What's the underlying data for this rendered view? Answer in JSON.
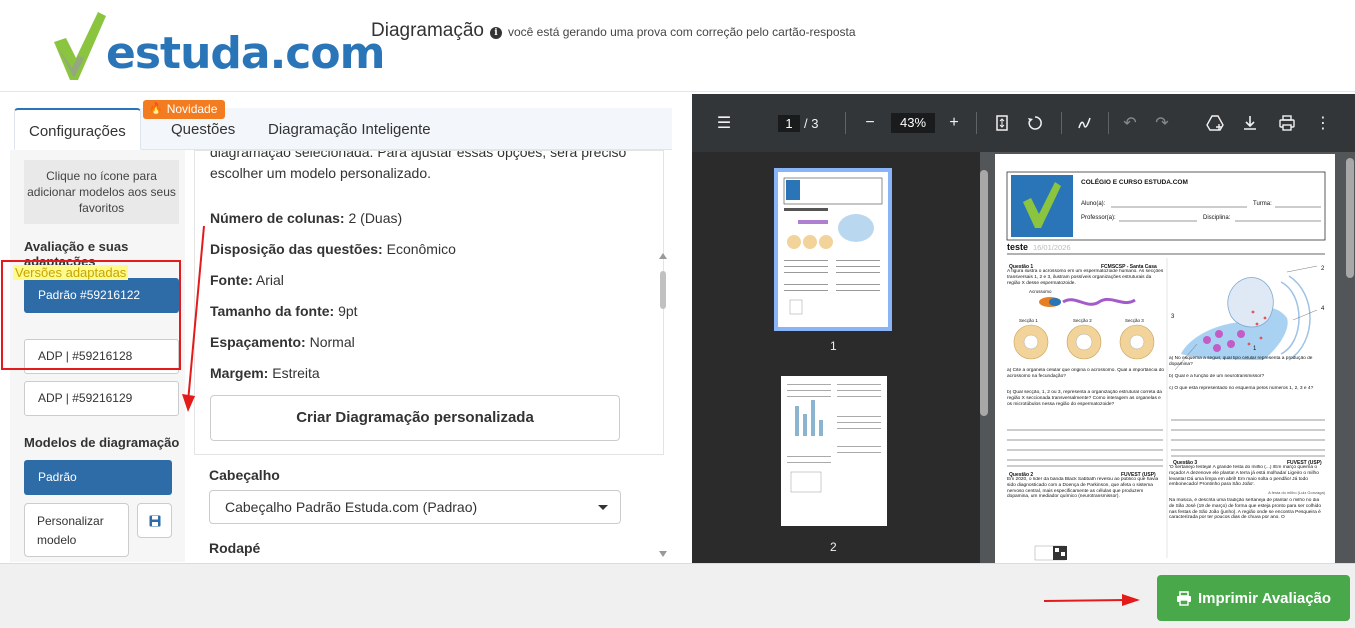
{
  "header": {
    "brand": "estuda.com",
    "page_title": "Diagramação",
    "subtitle": "você está gerando uma prova com correção pelo cartão-resposta"
  },
  "tabs": [
    {
      "label": "Configurações",
      "active": true
    },
    {
      "label": "Questões",
      "active": false
    },
    {
      "label": "Diagramação Inteligente",
      "active": false
    }
  ],
  "badge": {
    "label": "Novidade"
  },
  "sidebar": {
    "favorites_hint": "Clique no ícone para adicionar modelos aos seus favoritos",
    "assessment_label": "Avaliação e suas adaptações",
    "assessment_button": "Padrão #59216122",
    "versions_label": "Versões adaptadas",
    "versions": [
      "ADP | #59216128",
      "ADP | #59216129"
    ],
    "models_label": "Modelos de diagramação",
    "model_default": "Padrão",
    "model_custom": "Personalizar modelo"
  },
  "config": {
    "intro_line1": "diagramação selecionada. Para ajustar essas opções, será preciso",
    "intro_line2": "escolher um modelo personalizado.",
    "properties": [
      {
        "label": "Número de colunas:",
        "value": " 2 (Duas)"
      },
      {
        "label": "Disposição das questões:",
        "value": " Econômico"
      },
      {
        "label": "Fonte:",
        "value": " Arial"
      },
      {
        "label": "Tamanho da fonte:",
        "value": " 9pt"
      },
      {
        "label": "Espaçamento:",
        "value": " Normal"
      },
      {
        "label": "Margem:",
        "value": " Estreita"
      }
    ],
    "create_button": "Criar Diagramação personalizada",
    "header_label": "Cabeçalho",
    "header_select": "Cabeçalho Padrão Estuda.com (Padrao)",
    "footer_label": "Rodapé"
  },
  "viewer": {
    "current_page": "1",
    "total_pages": "/  3",
    "zoom": "43%",
    "thumb_labels": [
      "1",
      "2"
    ],
    "doc": {
      "school": "COLÉGIO E CURSO ESTUDA.COM",
      "student": "Aluno(a):",
      "class": "Turma:",
      "teacher": "Professor(a):",
      "subject": "Disciplina:",
      "test_title": "teste",
      "test_date": "16/01/2026",
      "q1_label": "Questão 1",
      "q1_source": "FCMSCSP - Santa Casa",
      "q1_text": "A figura ilustra o acrossomo em um espermatozoide humano. As secções transversais 1, 2 e 3, ilustram possíveis organizações estruturais da região X desse espermatozoide.",
      "acrossomo": "Acrossomo",
      "secoes": [
        "Secção 1",
        "Secção 2",
        "Secção 3"
      ],
      "q1a": "a) Cite a organela celular que origina o acrossomo. Qual a importância do acrossomo na fecundação?",
      "q1b": "b) Qual secção, 1, 2 ou 3, representa a organização estrutural correta da região X seccionada transversalmente? Como interagem as organelas e os microtúbulos nessa região do espermatozoide?",
      "q2_label": "Questão 2",
      "q2_source": "FUVEST (USP)",
      "q2_text": "Em 2020, o líder da banda Black Sabbath revelou ao público que havia sido diagnosticado com a Doença de Parkinson, que afeta o sistema nervoso central, mais especificamente as células que produzem dopamina, um mediador químico (neurotransmissor).",
      "right_a": "a) No esquema a seguir, qual tipo celular representa a produção de dopamina?",
      "right_b": "b) Qual é a função de um neurotransmissor?",
      "right_c": "c) O que está representado no esquema pelos números 1, 2, 3 e 4?",
      "q3_label": "Questão 3",
      "q3_source": "FUVEST (USP)",
      "q3_text": "'O sertanejo festeja! A grande festa do milho (...) /Em março queima o roçado! A dezenove ele planta! A terra já está molhada/ Ligeiro o milho levanta! Dá uma limpa em abril! Em maio solta o pendão! Já todo embonecado/ Prontinho para São João'.",
      "q3_cite": "A festa do milho (Luiz Gonzaga)",
      "q3_text2": "Na música, é descrita uma tradição sertaneja de plantar o milho no dia de São José (19 de março) de forma que esteja pronto para ser colhido nas festas de São João (junho). A região onde se encontra Pesqueira é caracterizada por ter poucos dias de chuva por ano. O",
      "n1": "1",
      "n2": "2",
      "n3": "3",
      "n4": "4"
    }
  },
  "footer": {
    "print_button": "Imprimir Avaliação"
  },
  "colors": {
    "primary": "#2e6ca8",
    "success": "#48a84a",
    "badge": "#f47c20",
    "annotation": "#e31b1b",
    "highlight": "#fffa8c"
  }
}
